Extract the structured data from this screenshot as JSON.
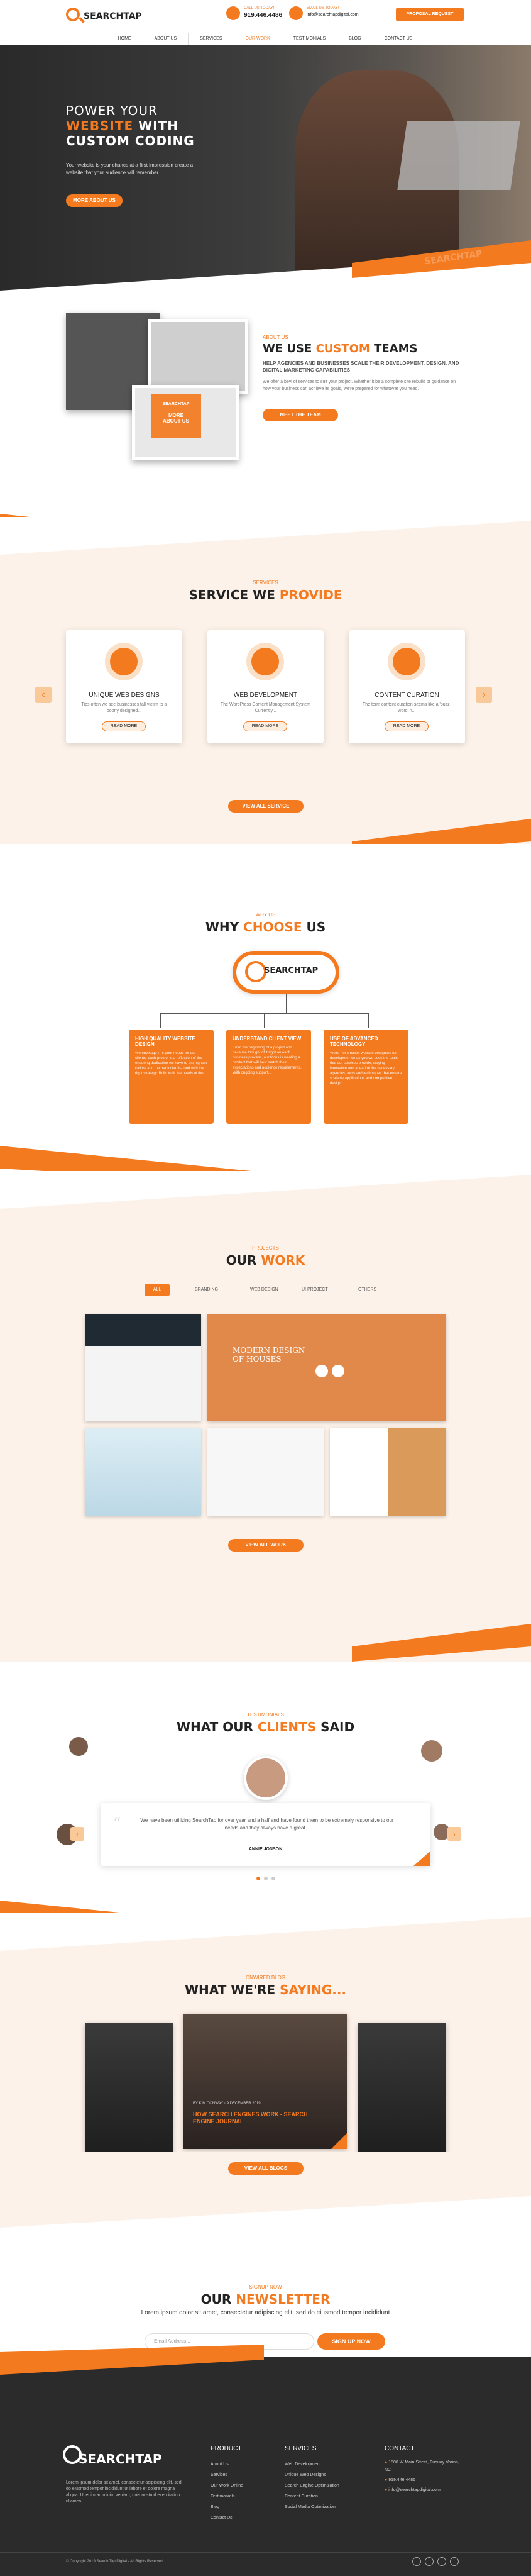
{
  "header": {
    "logo": "SEARCHTAP",
    "call_label": "CALL US TODAY!",
    "call_value": "919.446.4486",
    "mail_label": "EMAIL US TODAY!",
    "mail_value": "info@searchtapdigital.com",
    "proposal": "PROPOSAL REQUEST"
  },
  "nav": [
    "HOME",
    "ABOUT US",
    "SERVICES",
    "OUR WORK",
    "TESTIMONIALS",
    "BLOG",
    "CONTACT US"
  ],
  "hero": {
    "line1": "POWER YOUR",
    "line2a": "WEBSITE",
    "line2b": " WITH",
    "line3": "CUSTOM CODING",
    "desc": "Your website is your chance at a first impression create a website that your audience will remember.",
    "btn": "MORE ABOUT US",
    "watermark": "SEARCHTAP"
  },
  "about": {
    "small": "ABOUT US",
    "title_a": "WE USE ",
    "title_b": "CUSTOM",
    "title_c": " TEAMS",
    "sub": "HELP AGENCIES AND BUSINESSES SCALE THEIR DEVELOPMENT, DESIGN, AND DIGITAL MARKETING CAPABILITIES",
    "desc": "We offer a bevi of services to suit your project. Whether it be a complete site rebuild or guidance on how your business can achieve its goals, we're prepared for whatever you need.",
    "btn": "MEET THE TEAM",
    "badge_logo": "SEARCHTAP",
    "badge": "MORE ABOUT US"
  },
  "services": {
    "small": "SERVICES",
    "title_a": "SERVICE WE ",
    "title_b": "PROVIDE",
    "items": [
      {
        "title": "UNIQUE WEB DESIGNS",
        "desc": "Tips often we see businesses fall victim to a poorly designed...",
        "btn": "READ MORE"
      },
      {
        "title": "WEB DEVELOPMENT",
        "desc": "The WordPress Content Management System Currently...",
        "btn": "READ MORE"
      },
      {
        "title": "CONTENT CURATION",
        "desc": "The term content curation seems like a 'buzz-word' n...",
        "btn": "READ MORE"
      }
    ],
    "all": "VIEW ALL SERVICE",
    "prev": "‹",
    "next": "›"
  },
  "why": {
    "small": "WHY US",
    "title_a": "WHY ",
    "title_b": "CHOOSE",
    "title_c": " US",
    "logo": "SEARCHTAP",
    "items": [
      {
        "title": "HIGH QUALITY WEBSITE DESIGN",
        "desc": "We envisage IT's prior needs for our clients, each project is a reflection of the enduring dedication we have to the highest calibre and the particular fit-good with the right strategy. Build to fit the needs of the..."
      },
      {
        "title": "UNDERSTAND CLIENT VIEW",
        "desc": "From the beginning of a project and because thought of it right on each business process, our focus is wanting a product that will best match their expectations and audience requirements. With ongoing support..."
      },
      {
        "title": "USE OF ADVANCED TECHNOLOGY",
        "desc": "We're not smaller, website designers for developers, we as you we seek the tools that our services provide, staying innovative and ahead of the necessary agencies, tools and techniques that ensure scalable applications and competitive design..."
      }
    ]
  },
  "work": {
    "small": "PROJECTS",
    "title_a": "OUR ",
    "title_b": "WORK",
    "filters": [
      "ALL",
      "BRANDING",
      "WEB DESIGN",
      "UI PROJECT",
      "OTHERS"
    ],
    "feature": "MODERN DESIGN OF HOUSES",
    "btn": "VIEW ALL WORK"
  },
  "testimonials": {
    "small": "TESTIMONIALS",
    "title_a": "WHAT OUR ",
    "title_b": "CLIENTS",
    "title_c": " SAID",
    "quote": "We have been utilizing SearchTap for over year and a half and have found them to be extremely responsive to our needs and they always have a great...",
    "name": "ANNIE JONSON",
    "prev": "‹",
    "next": "›"
  },
  "blog": {
    "small": "ONWIRED BLOG",
    "title_a": "WHAT WE'RE ",
    "title_b": "SAYING...",
    "meta": "BY KIM CONWAY ◦ 9 DECEMBER 2019",
    "post": "HOW SEARCH ENGINES WORK - SEARCH ENGINE JOURNAL",
    "btn": "VIEW ALL BLOGS"
  },
  "newsletter": {
    "small": "SIGNUP NOW",
    "title_a": "OUR ",
    "title_b": "NEWSLETTER",
    "desc": "Lorem ipsum dolor sit amet, consectetur adipiscing elit, sed do eiusmod tempor incididunt",
    "placeholder": "Email Address...",
    "btn": "SIGN UP NOW"
  },
  "footer": {
    "logo": "SEARCHTAP",
    "about": "Lorem ipsum dolor sit amet, consectetur adipiscing elit, sed do eiusmod tempor incididunt ut labore et dolore magna aliqua. Ut enim ad minim veniam, quis nostrud exercitation ullamco.",
    "product_title": "PRODUCT",
    "product": [
      "About Us",
      "Services",
      "Our Work Online",
      "Testimonials",
      "Blog",
      "Contact Us"
    ],
    "services_title": "SERVICES",
    "services": [
      "Web Development",
      "Unique Web Designs",
      "Search Engine Optimization",
      "Content Curation",
      "Social Media Optimization"
    ],
    "contact_title": "CONTACT",
    "contact": [
      "1800 W Main Street, Fuquay Varina, NC",
      "919.446.4486",
      "info@searchtapdigital.com"
    ],
    "copyright": "© Copyright 2019 Search Tap Digital - All Rights Reserved."
  },
  "colors": {
    "accent": "#f47a20",
    "dark": "#2b2b2b"
  }
}
